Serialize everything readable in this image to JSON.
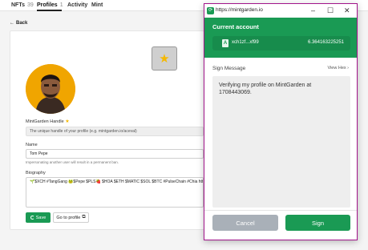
{
  "tabs": [
    {
      "label": "NFTs",
      "count": "39"
    },
    {
      "label": "Profiles",
      "count": "1"
    },
    {
      "label": "Activity",
      "count": ""
    },
    {
      "label": "Mint",
      "count": ""
    }
  ],
  "back_label": "Back",
  "form": {
    "handle_label": "MintGarden Handle",
    "handle_placeholder": "The unique handle of your profile (e.g. mintgarden.io/aceval)",
    "name_label": "Name",
    "name_value": "Tom Pepe",
    "name_hint": "Impersonating another user will result in a permanent ban.",
    "bio_label": "Biography",
    "bio_value": "🌱$XCH #TangGang 🐸$Pepe $PLS🍓 $HOA $ETH $MATIC $SOL $BTC #PulseChain #Chia https://",
    "save_label": "Save",
    "goto_label": "Go to profile"
  },
  "popup": {
    "url": "https://mintgarden.io",
    "current_account_label": "Current account",
    "address": "xch1zf...xf99",
    "balance": "6.364163225251",
    "sign_message_label": "Sign Message",
    "view_hex_label": "View Hex ›",
    "message": "Verifying my profile on MintGarden at 1708443069.",
    "cancel_label": "Cancel",
    "sign_label": "Sign"
  },
  "colors": {
    "accent_green": "#1a9a54",
    "popup_border": "#a1148a",
    "cancel_gray": "#a9b0b8"
  }
}
